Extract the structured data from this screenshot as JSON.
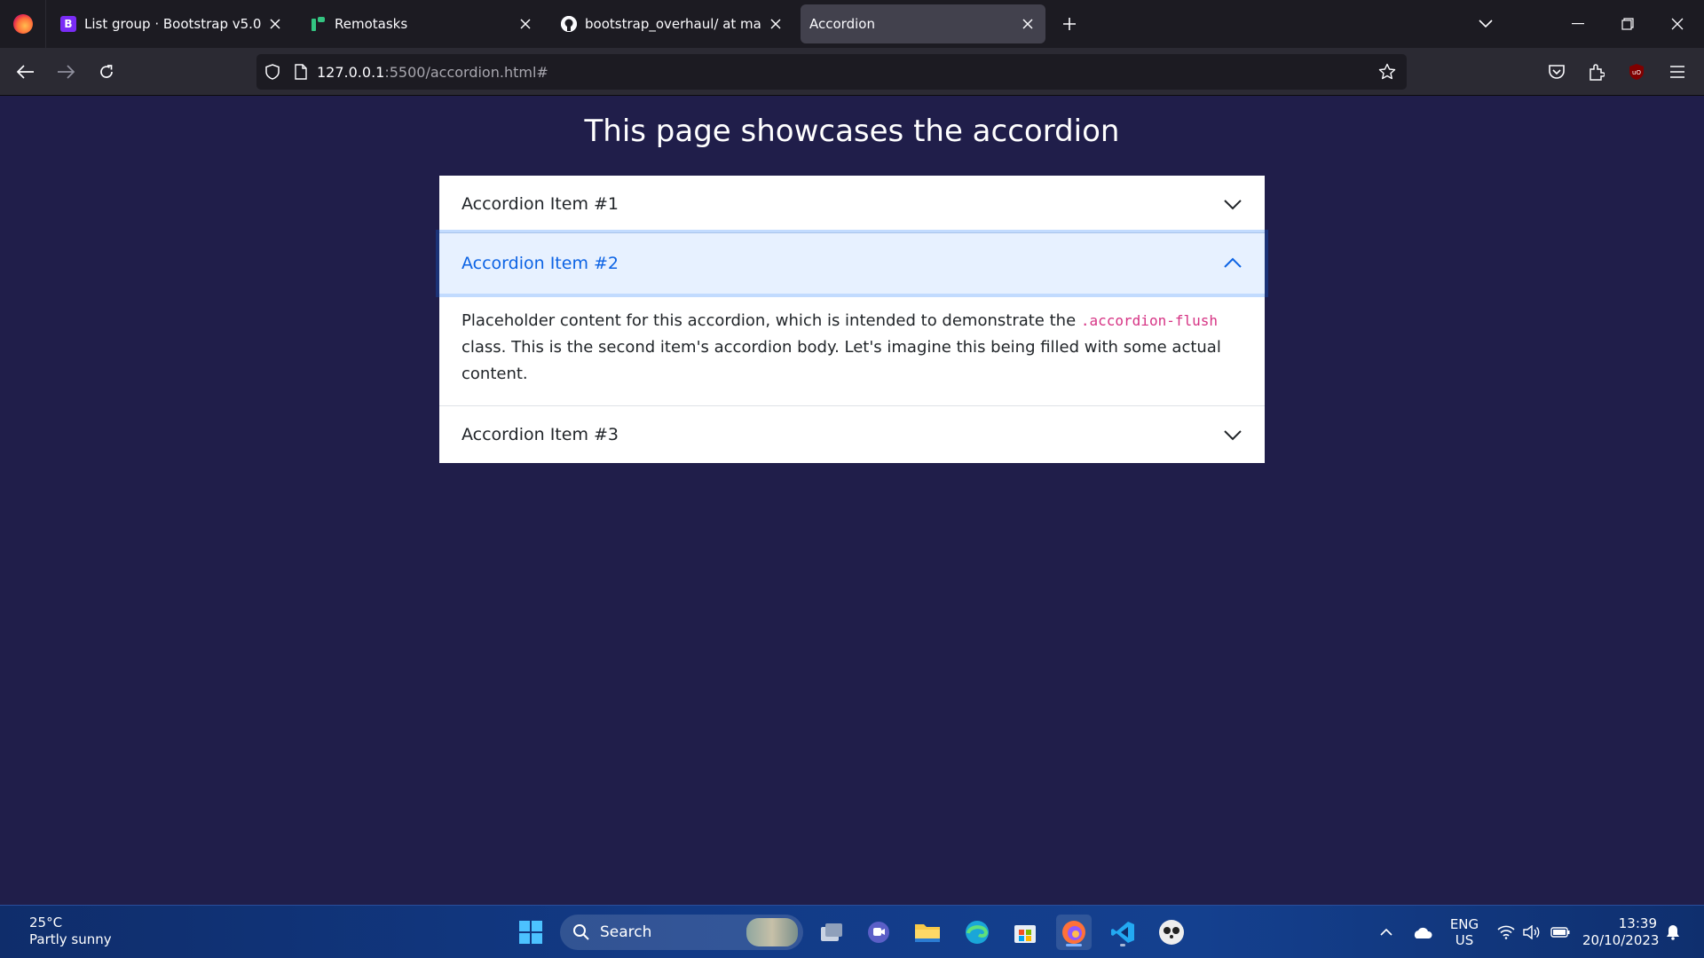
{
  "browser": {
    "tabs": [
      {
        "title": "List group · Bootstrap v5.0",
        "favicon": "bootstrap-icon",
        "active": false
      },
      {
        "title": "Remotasks",
        "favicon": "remotasks-icon",
        "active": false
      },
      {
        "title": "bootstrap_overhaul/ at main · M",
        "favicon": "github-icon",
        "active": false
      },
      {
        "title": "Accordion",
        "favicon": "",
        "active": true
      }
    ],
    "url_host": "127.0.0.1",
    "url_rest": ":5500/accordion.html#"
  },
  "page": {
    "heading": "This page showcases the accordion",
    "accordion": {
      "items": [
        {
          "label": "Accordion Item #1",
          "expanded": false
        },
        {
          "label": "Accordion Item #2",
          "expanded": true,
          "body_before": "Placeholder content for this accordion, which is intended to demonstrate the ",
          "body_code": ".accordion-flush",
          "body_after": " class. This is the second item's accordion body. Let's imagine this being filled with some actual content."
        },
        {
          "label": "Accordion Item #3",
          "expanded": false
        }
      ]
    },
    "colors": {
      "background": "#201e4a",
      "active_header_bg": "#e7f1ff",
      "active_header_text": "#0c63e4",
      "code_text": "#d63384"
    }
  },
  "taskbar": {
    "weather_temp": "25°C",
    "weather_desc": "Partly sunny",
    "search_label": "Search",
    "lang_line1": "ENG",
    "lang_line2": "US",
    "time": "13:39",
    "date": "20/10/2023"
  }
}
